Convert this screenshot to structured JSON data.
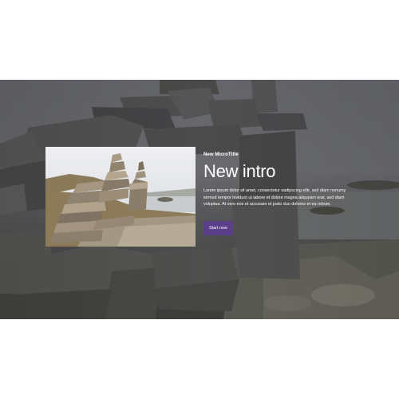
{
  "hero": {
    "background_image": "stone-cairn-photo",
    "thumbnail_image": "stone-cairn-photo",
    "eyebrow": "New MicroTitle",
    "title": "New intro",
    "body": "Lorem ipsum dolor sit amet, consectetur sadipscing elitr, sed diam nonumy eirmod tempor invidunt ut labore et dolore magna aliquyam erat, sed diam voluptua. At vero eos et accusam et justo duo dolores et ea rebum.",
    "cta_label": "Start now"
  },
  "colors": {
    "cta_background": "#5c3f8a",
    "page_background": "#ffffff",
    "text": "#ffffff"
  }
}
